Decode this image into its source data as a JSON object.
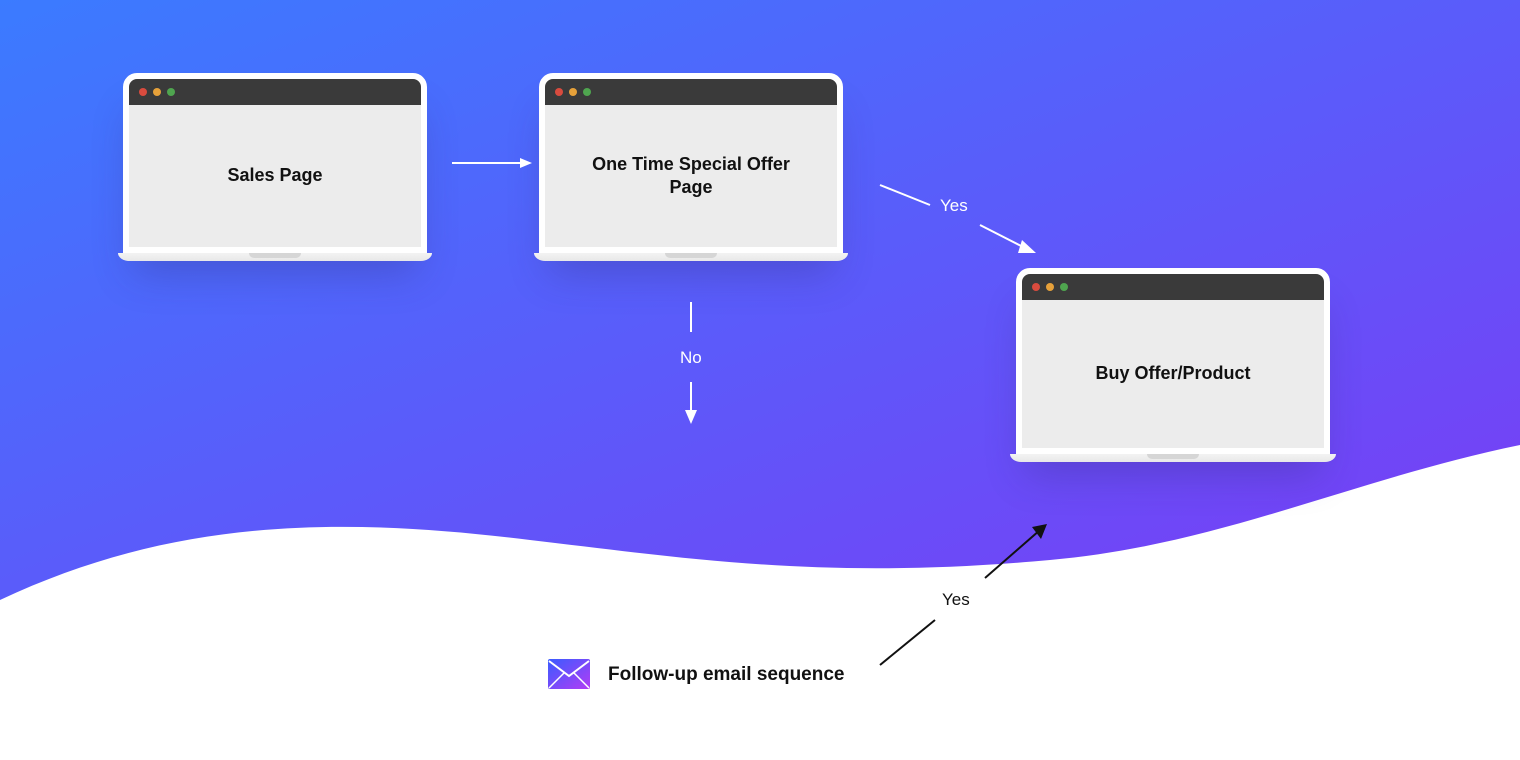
{
  "laptops": {
    "sales": "Sales Page",
    "offer": "One Time Special Offer Page",
    "buy": "Buy Offer/Product"
  },
  "labels": {
    "yes1": "Yes",
    "no": "No",
    "yes2": "Yes"
  },
  "email": {
    "label": "Follow-up email sequence"
  },
  "colors": {
    "gradStart": "#3b7bff",
    "gradEnd": "#7a3cf5",
    "iconStart": "#3a5cff",
    "iconEnd": "#b23cf5"
  }
}
